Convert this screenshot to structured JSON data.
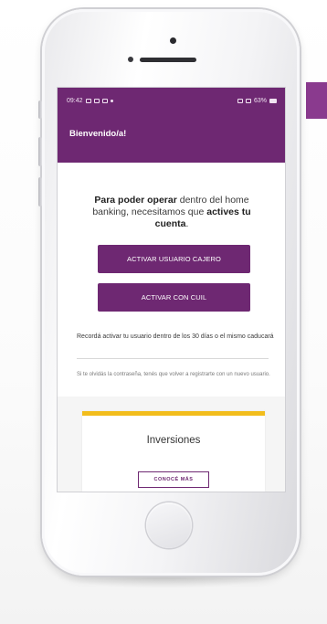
{
  "status_bar": {
    "time": "09:42",
    "signal_battery": "63%"
  },
  "header": {
    "title": "Bienvenido/a!"
  },
  "intro": {
    "part1": "Para poder operar",
    "part2": " dentro del home banking, necesitamos que ",
    "part3": "actives tu cuenta",
    "part4": "."
  },
  "buttons": {
    "activate_atm_user": "ACTIVAR USUARIO CAJERO",
    "activate_cuil": "ACTIVAR CON CUIL"
  },
  "reminder": "Recordá activar tu usuario dentro de los 30 días o el mismo caducará",
  "forgot_password": "Si te olvidás la contraseña, tenés que volver a registrarte con un nuevo usuario.",
  "card": {
    "title": "Inversiones",
    "button": "CONOCÉ MÁS"
  },
  "colors": {
    "brand_purple": "#6e2872",
    "card_stripe_yellow": "#f2bd1c"
  },
  "icons": [
    "status-notification-icon",
    "battery-icon",
    "home-button"
  ]
}
